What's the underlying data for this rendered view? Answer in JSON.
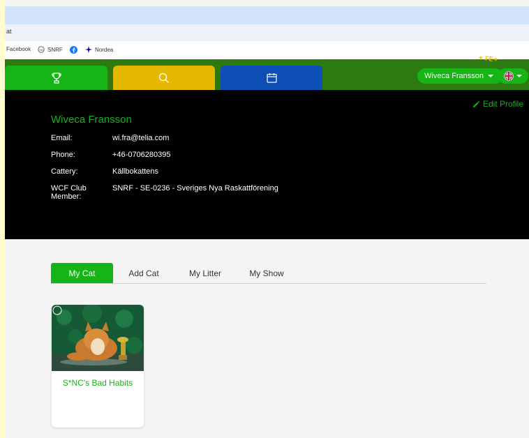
{
  "browser": {
    "address_fragment": "at",
    "bookmarks": [
      "Facebook",
      "SNRF",
      "Nordea"
    ]
  },
  "nav": {
    "tabs": [
      {
        "icon": "trophy-icon",
        "color": "#14b514"
      },
      {
        "icon": "search-icon",
        "color": "#e4b800"
      },
      {
        "icon": "calendar-icon",
        "color": "#0d4fb5"
      }
    ],
    "user_name": "Wiveca Fransson",
    "language_icon": "uk-flag-icon"
  },
  "profile": {
    "edit_label": "Edit Profile",
    "name": "Wiveca Fransson",
    "fields": [
      {
        "label": "Email:",
        "value": "wi.fra@telia.com"
      },
      {
        "label": "Phone:",
        "value": "+46-0706280395"
      },
      {
        "label": "Cattery:",
        "value": "Källbokattens"
      },
      {
        "label": "WCF Club Member:",
        "value": "SNRF - SE-0236 - Sveriges Nya Raskattförening"
      }
    ]
  },
  "tabs": [
    "My Cat",
    "Add Cat",
    "My Litter",
    "My Show"
  ],
  "active_tab": "My Cat",
  "cats": [
    {
      "name": "S*NC's Bad Habits"
    }
  ],
  "colors": {
    "accent_green": "#14b514",
    "nav_green": "#2d7a10",
    "yellow": "#e4b800",
    "blue": "#0d4fb5"
  }
}
